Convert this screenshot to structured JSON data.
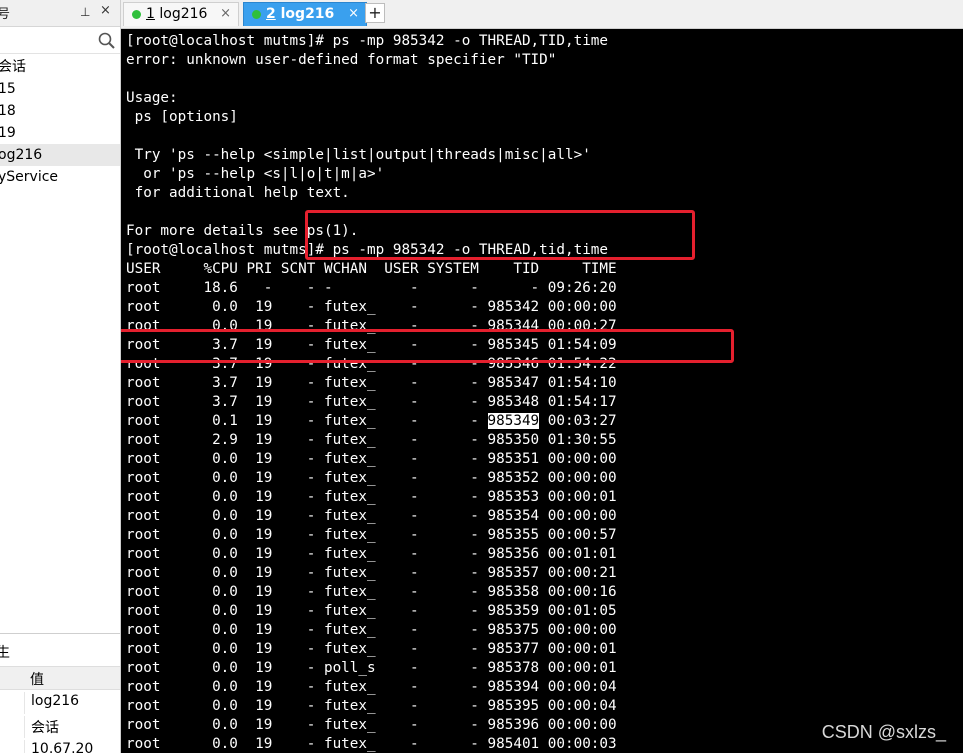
{
  "left_panel": {
    "title": "号",
    "pin_icon": "pin-icon",
    "close_icon": "close-icon",
    "search_icon": "search-icon",
    "sessions": [
      {
        "label": "会话"
      },
      {
        "label": "15"
      },
      {
        "label": "18"
      },
      {
        "label": "19"
      },
      {
        "label": "og216"
      },
      {
        "label": "yService"
      }
    ]
  },
  "properties": {
    "title": "生",
    "header_value": "值",
    "rows": [
      "log216",
      "会话",
      "10.67.20"
    ]
  },
  "tabs": [
    {
      "num": "1",
      "name": " log216",
      "close": "×",
      "active": false
    },
    {
      "num": "2",
      "name": " log216",
      "close": "×",
      "active": true
    }
  ],
  "new_tab": "+",
  "terminal": {
    "lines": [
      "[root@localhost mutms]# ps -mp 985342 -o THREAD,TID,time",
      "error: unknown user-defined format specifier \"TID\"",
      "",
      "Usage:",
      " ps [options]",
      "",
      " Try 'ps --help <simple|list|output|threads|misc|all>'",
      "  or 'ps --help <s|l|o|t|m|a>'",
      " for additional help text.",
      "",
      "For more details see ps(1).",
      "[root@localhost mutms]# ps -mp 985342 -o THREAD,tid,time",
      "USER     %CPU PRI SCNT WCHAN  USER SYSTEM    TID     TIME",
      "root     18.6   -    - -         -      -      - 09:26:20",
      "root      0.0  19    - futex_    -      - 985342 00:00:00",
      "root      0.0  19    - futex_    -      - 985344 00:00:27",
      "root      3.7  19    - futex_    -      - 985345 01:54:09",
      "root      3.7  19    - futex_    -      - 985346 01:54:22",
      "root      3.7  19    - futex_    -      - 985347 01:54:10",
      "root      3.7  19    - futex_    -      - 985348 01:54:17",
      "",
      "root      2.9  19    - futex_    -      - 985350 01:30:55",
      "root      0.0  19    - futex_    -      - 985351 00:00:00",
      "root      0.0  19    - futex_    -      - 985352 00:00:00",
      "root      0.0  19    - futex_    -      - 985353 00:00:01",
      "root      0.0  19    - futex_    -      - 985354 00:00:00",
      "root      0.0  19    - futex_    -      - 985355 00:00:57",
      "root      0.0  19    - futex_    -      - 985356 00:01:01",
      "root      0.0  19    - futex_    -      - 985357 00:00:21",
      "root      0.0  19    - futex_    -      - 985358 00:00:16",
      "root      0.0  19    - futex_    -      - 985359 00:01:05",
      "root      0.0  19    - futex_    -      - 985375 00:00:00",
      "root      0.0  19    - futex_    -      - 985377 00:00:01",
      "root      0.0  19    - poll_s    -      - 985378 00:00:01",
      "root      0.0  19    - futex_    -      - 985394 00:00:04",
      "root      0.0  19    - futex_    -      - 985395 00:00:04",
      "root      0.0  19    - futex_    -      - 985396 00:00:00",
      "root      0.0  19    - futex_    -      - 985401 00:00:03"
    ],
    "selected_line": {
      "prefix": "root      0.1  19    - futex_    -      - ",
      "selected": "985349",
      "suffix": " 00:03:27"
    },
    "watermark": "CSDN @sxlzs_"
  },
  "colors": {
    "terminal_bg": "#000000",
    "terminal_fg": "#ffffff",
    "active_tab": "#3aa0ee",
    "status_dot": "#2fbf3b",
    "highlight": "#e5202e"
  }
}
